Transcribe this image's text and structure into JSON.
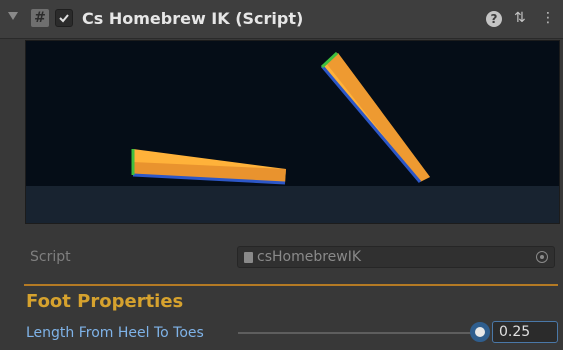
{
  "component": {
    "title": "Cs Homebrew IK (Script)",
    "script_icon_glyph": "#",
    "enabled": true,
    "help_glyph": "?",
    "presets_glyph": "⇅",
    "menu_glyph": "⋮"
  },
  "preview": {
    "background": "#050d17",
    "ground": "#182330",
    "bone_fill": "#ffb23a",
    "bone_shadow": "#e0862a",
    "edge_blue": "#2d57c7",
    "edge_green": "#3fbf3f"
  },
  "script_field": {
    "label": "Script",
    "value": "csHomebrewIK"
  },
  "foot_properties": {
    "title": "Foot Properties",
    "length_label": "Length From Heel To Toes",
    "length_value": "0.25",
    "slider_fraction": 0.95
  },
  "colors": {
    "accent_orange": "#d6a22e",
    "label_blue": "#7fb3e8"
  }
}
